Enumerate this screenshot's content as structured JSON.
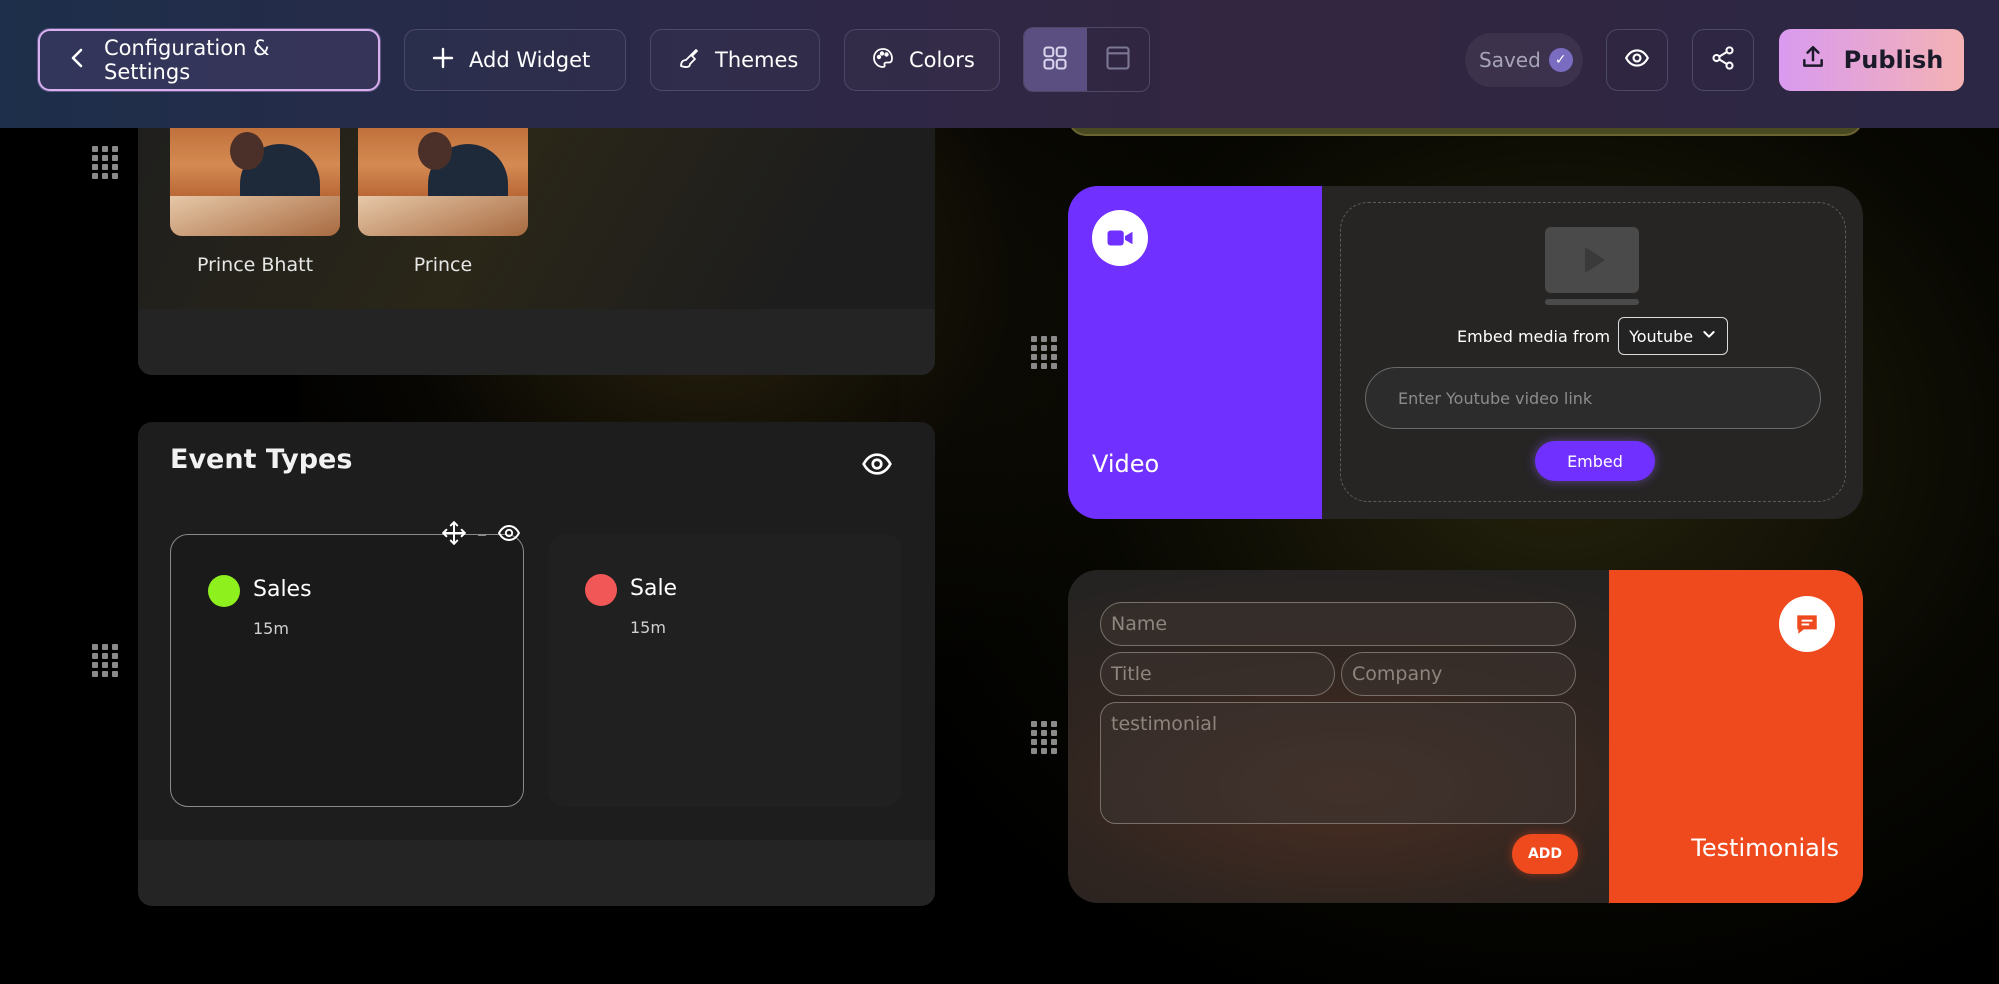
{
  "toolbar": {
    "config_label": "Configuration & Settings",
    "add_widget_label": "Add Widget",
    "themes_label": "Themes",
    "colors_label": "Colors",
    "saved_label": "Saved",
    "publish_label": "Publish"
  },
  "team": {
    "members": [
      {
        "name": "Prince Bhatt"
      },
      {
        "name": "Prince"
      }
    ]
  },
  "events": {
    "title": "Event Types",
    "cards": [
      {
        "name": "Sales",
        "duration": "15m",
        "color": "#8ef01c"
      },
      {
        "name": "Sale",
        "duration": "15m",
        "color": "#f25757"
      }
    ]
  },
  "video": {
    "title": "Video",
    "embed_label": "Embed media from",
    "source": "Youtube",
    "input_placeholder": "Enter Youtube video link",
    "embed_button": "Embed",
    "accent": "#7030ff"
  },
  "testimonials": {
    "title": "Testimonials",
    "name_placeholder": "Name",
    "title_placeholder": "Title",
    "company_placeholder": "Company",
    "testimonial_placeholder": "testimonial",
    "add_button": "ADD",
    "accent": "#ee4a1e"
  }
}
